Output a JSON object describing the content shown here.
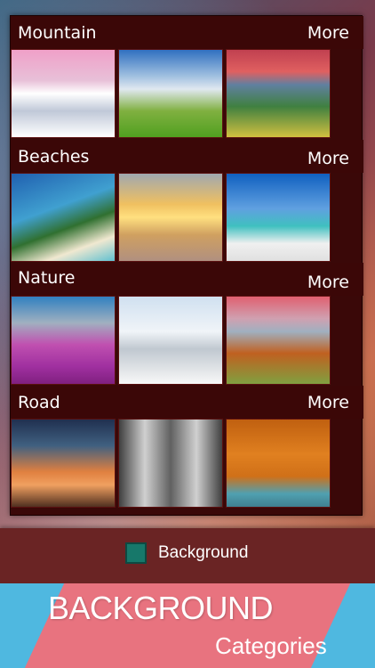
{
  "sections": [
    {
      "title": "Mountain",
      "more": "More"
    },
    {
      "title": "Beaches",
      "more": "More"
    },
    {
      "title": "Nature",
      "more": "More"
    },
    {
      "title": "Road",
      "more": "More"
    }
  ],
  "thumbnails": {
    "mountain": [
      "snowy-pink-mountain",
      "green-meadow-sky",
      "green-hills-sunset"
    ],
    "beaches": [
      "palm-beach",
      "lifeguard-tower-sunset",
      "tropical-palm-beach"
    ],
    "nature": [
      "purple-lavender-tree",
      "snowy-road",
      "autumn-valley"
    ],
    "road": [
      "sunset-road",
      "snowy-forest-road",
      "autumn-forest-road"
    ]
  },
  "footer": {
    "checkbox_label": "Background"
  },
  "banner": {
    "title": "BACKGROUND",
    "subtitle": "Categories"
  },
  "colors": {
    "panel": "#3a0808",
    "accent": "#17786a",
    "banner_pink": "#e8737f",
    "banner_blue": "#4fb8e0"
  }
}
